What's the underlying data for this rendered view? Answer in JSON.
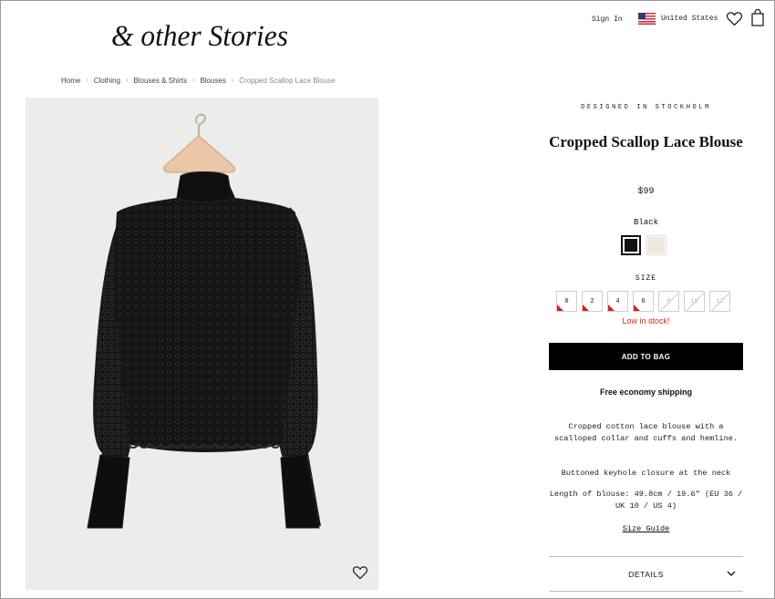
{
  "header": {
    "logo_text": "& other Stories",
    "sign_in": "Sign In",
    "country": "United States",
    "icons": [
      "flag-us-icon",
      "heart-icon",
      "shopping-bag-icon"
    ]
  },
  "breadcrumb": [
    "Home",
    "Clothing",
    "Blouses & Shirts",
    "Blouses",
    "Cropped Scallop Lace Blouse"
  ],
  "product": {
    "eyebrow": "DESIGNED IN STOCKHOLM",
    "title": "Cropped Scallop Lace Blouse",
    "price": "$99",
    "color_selected": "Black",
    "colors": [
      {
        "name": "Black",
        "hex": "#111111",
        "selected": true
      },
      {
        "name": "Cream",
        "hex": "#eee8d8",
        "selected": false
      }
    ],
    "size_label": "SIZE",
    "sizes": [
      {
        "label": "0",
        "status": "low"
      },
      {
        "label": "2",
        "status": "low"
      },
      {
        "label": "4",
        "status": "low"
      },
      {
        "label": "6",
        "status": "low"
      },
      {
        "label": "8",
        "status": "unavailable"
      },
      {
        "label": "10",
        "status": "unavailable"
      },
      {
        "label": "12",
        "status": "unavailable"
      }
    ],
    "stock_message": "Low in stock!",
    "add_to_bag": "ADD TO BAG",
    "shipping": "Free economy shipping",
    "description_1": "Cropped cotton lace blouse with a scalloped collar and cuffs and hemline.",
    "description_2": "Buttoned keyhole closure at the neck",
    "description_3": "Length of blouse: 49.8cm / 19.6\" (EU 36 / UK 10 / US 4)",
    "size_guide": "Size Guide",
    "details": "DETAILS"
  },
  "colors": {
    "accent_red": "#e41b1b",
    "button_black": "#000000",
    "image_background": "#ececea"
  }
}
